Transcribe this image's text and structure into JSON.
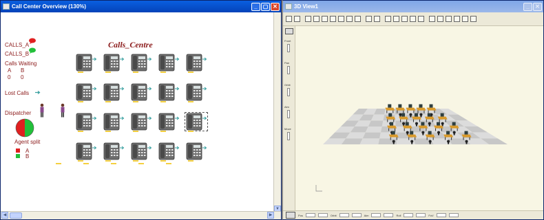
{
  "left_window": {
    "title": "Call Center Overview (130%)"
  },
  "right_window": {
    "title": "3D View1"
  },
  "diagram": {
    "title": "Calls_Centre",
    "calls_a_label": "CALLS_A",
    "calls_b_label": "CALLS_B",
    "calls_waiting_label": "Calls Waiting",
    "waiting_a_header": "A",
    "waiting_b_header": "B",
    "waiting_a_value": "0",
    "waiting_b_value": "0",
    "lost_calls_label": "Lost Calls",
    "dispatcher_label": "Dispatcher",
    "agent_split_label": "Agent split",
    "agent_a_label": "A",
    "agent_b_label": "B",
    "colors": {
      "a": "#e02020",
      "b": "#22c03a",
      "text": "#8b1a1a",
      "title_bar": "#0443b9"
    }
  },
  "view3d": {
    "side_labels": [
      "Front",
      "Pan",
      "Orbit",
      "Aim",
      "Move"
    ],
    "status_labels": [
      "Pos",
      "Orbit",
      "Aim",
      "Roll",
      "FoV"
    ]
  }
}
